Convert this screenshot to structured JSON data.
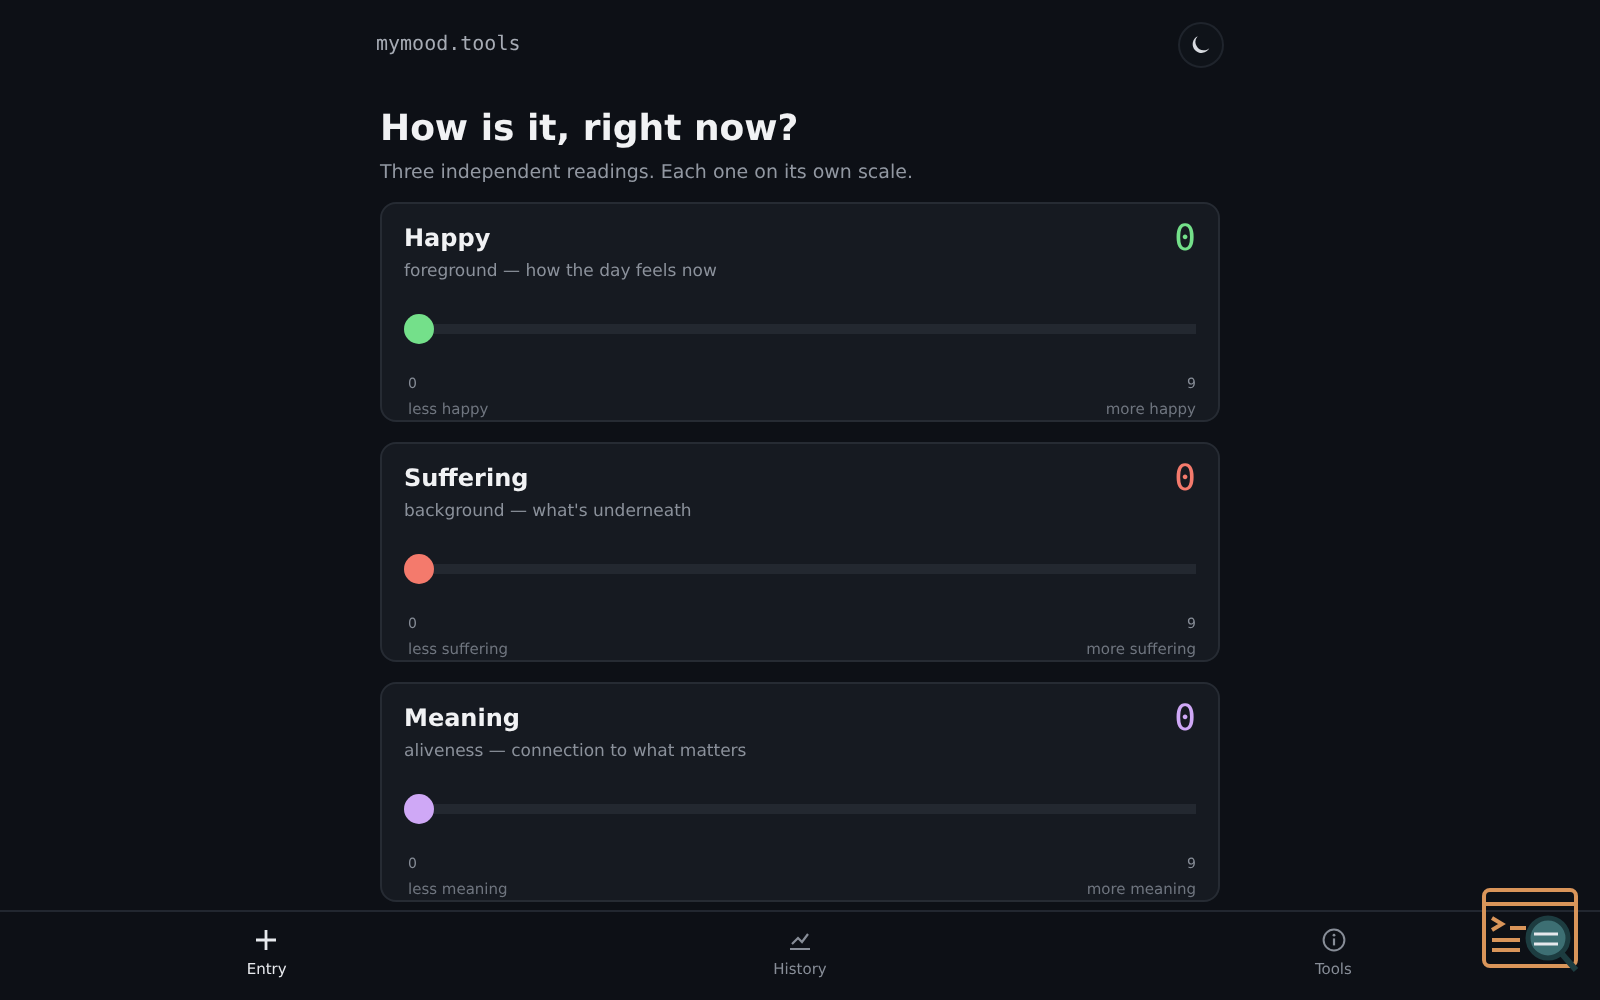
{
  "header": {
    "brand": "mymood.tools"
  },
  "title": "How is it, right now?",
  "subtitle": "Three independent readings. Each one on its own scale.",
  "metrics": [
    {
      "name": "Happy",
      "description": "foreground — how the day feels now",
      "value": "0",
      "level": 0,
      "color": "#74e08a",
      "min": "0",
      "max": "9",
      "min_label": "less happy",
      "max_label": "more happy"
    },
    {
      "name": "Suffering",
      "description": "background — what's underneath",
      "value": "0",
      "level": 0,
      "color": "#f47a6c",
      "min": "0",
      "max": "9",
      "min_label": "less suffering",
      "max_label": "more suffering"
    },
    {
      "name": "Meaning",
      "description": "aliveness — connection to what matters",
      "value": "0",
      "level": 0,
      "color": "#cfa8f6",
      "min": "0",
      "max": "9",
      "min_label": "less meaning",
      "max_label": "more meaning"
    }
  ],
  "nav": [
    {
      "label": "Entry",
      "selected": true
    },
    {
      "label": "History",
      "selected": false
    },
    {
      "label": "Tools",
      "selected": false
    }
  ]
}
